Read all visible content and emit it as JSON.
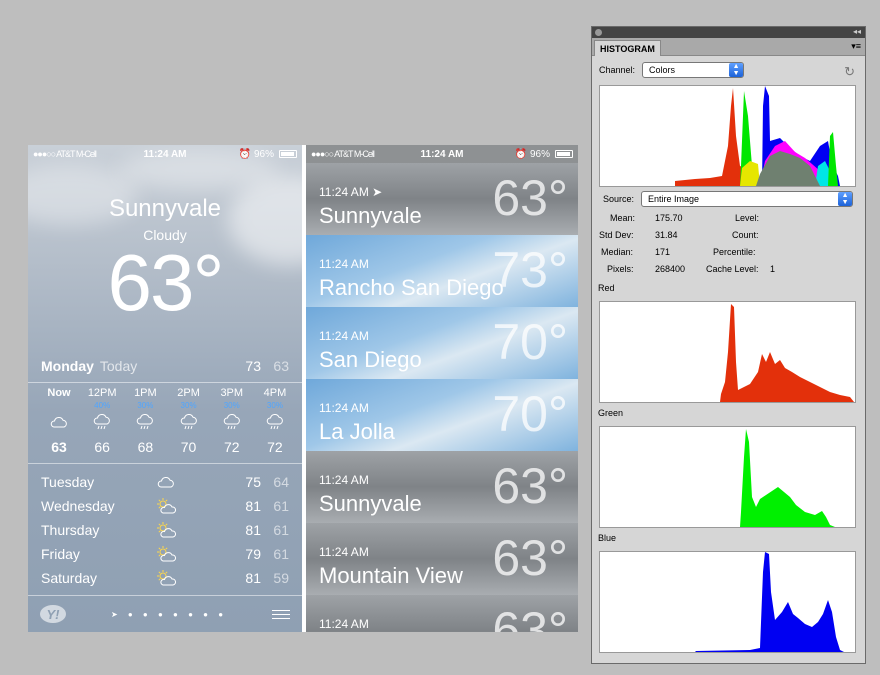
{
  "phone_left": {
    "status": {
      "carrier": "●●●○○ AT&T M-Cell",
      "time": "11:24 AM",
      "battery": "96%"
    },
    "city": "Sunnyvale",
    "condition": "Cloudy",
    "temp": "63°",
    "today": {
      "day": "Monday",
      "label": "Today",
      "hi": "73",
      "lo": "63"
    },
    "hourly": [
      {
        "label": "Now",
        "pct": "",
        "temp": "63"
      },
      {
        "label": "12PM",
        "pct": "40%",
        "temp": "66"
      },
      {
        "label": "1PM",
        "pct": "30%",
        "temp": "68"
      },
      {
        "label": "2PM",
        "pct": "30%",
        "temp": "70"
      },
      {
        "label": "3PM",
        "pct": "30%",
        "temp": "72"
      },
      {
        "label": "4PM",
        "pct": "30%",
        "temp": "72"
      }
    ],
    "forecast": [
      {
        "day": "Tuesday",
        "icon": "cloud-icon",
        "hi": "75",
        "lo": "64"
      },
      {
        "day": "Wednesday",
        "icon": "partly-sunny-icon",
        "hi": "81",
        "lo": "61"
      },
      {
        "day": "Thursday",
        "icon": "partly-sunny-icon",
        "hi": "81",
        "lo": "61"
      },
      {
        "day": "Friday",
        "icon": "partly-sunny-icon",
        "hi": "79",
        "lo": "61"
      },
      {
        "day": "Saturday",
        "icon": "partly-sunny-icon",
        "hi": "81",
        "lo": "59"
      }
    ],
    "footer": {
      "logo": "Y!",
      "page_dots": "➤ ● ● ● ● ● ● ●"
    }
  },
  "phone_right": {
    "status": {
      "carrier": "●●●○○ AT&T M-Cell",
      "time": "11:24 AM",
      "battery": "96%"
    },
    "cities": [
      {
        "time": "11:24 AM ➤",
        "name": "Sunnyvale",
        "temp": "63°",
        "style": "gray"
      },
      {
        "time": "11:24 AM",
        "name": "Rancho San Diego",
        "temp": "73°",
        "style": "blue"
      },
      {
        "time": "11:24 AM",
        "name": "San Diego",
        "temp": "70°",
        "style": "blue"
      },
      {
        "time": "11:24 AM",
        "name": "La Jolla",
        "temp": "70°",
        "style": "blue"
      },
      {
        "time": "11:24 AM",
        "name": "Sunnyvale",
        "temp": "63°",
        "style": "gray"
      },
      {
        "time": "11:24 AM",
        "name": "Mountain View",
        "temp": "63°",
        "style": "gray"
      },
      {
        "time": "11:24 AM",
        "name": "",
        "temp": "63°",
        "style": "gray"
      }
    ]
  },
  "histogram": {
    "tab": "HISTOGRAM",
    "channel_label": "Channel:",
    "channel_value": "Colors",
    "source_label": "Source:",
    "source_value": "Entire Image",
    "stats": {
      "mean_label": "Mean:",
      "mean": "175.70",
      "stddev_label": "Std Dev:",
      "stddev": "31.84",
      "median_label": "Median:",
      "median": "171",
      "pixels_label": "Pixels:",
      "pixels": "268400",
      "level_label": "Level:",
      "count_label": "Count:",
      "percentile_label": "Percentile:",
      "cache_label": "Cache Level:",
      "cache": "1"
    },
    "labels": {
      "red": "Red",
      "green": "Green",
      "blue": "Blue"
    }
  }
}
